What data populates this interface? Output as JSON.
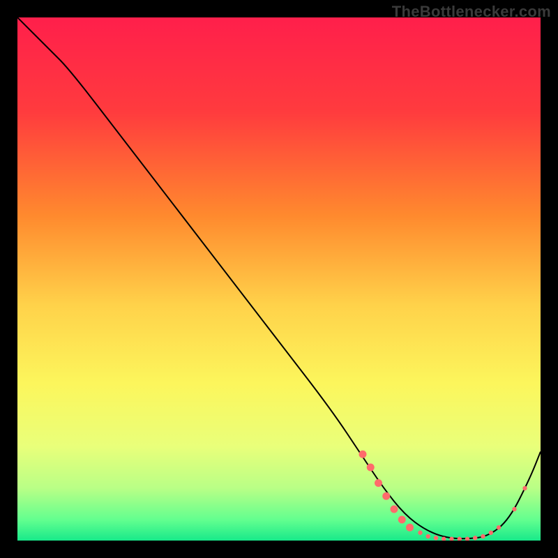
{
  "watermark": "TheBottlenecker.com",
  "chart_data": {
    "type": "line",
    "title": "",
    "xlabel": "",
    "ylabel": "",
    "xlim": [
      0,
      100
    ],
    "ylim": [
      0,
      100
    ],
    "background_gradient": {
      "stops": [
        {
          "offset": 0,
          "color": "#ff1f4b"
        },
        {
          "offset": 18,
          "color": "#ff3b3e"
        },
        {
          "offset": 38,
          "color": "#ff8a2e"
        },
        {
          "offset": 55,
          "color": "#ffd24a"
        },
        {
          "offset": 70,
          "color": "#fcf65c"
        },
        {
          "offset": 82,
          "color": "#e9ff7a"
        },
        {
          "offset": 90,
          "color": "#b9ff86"
        },
        {
          "offset": 96,
          "color": "#63ff8f"
        },
        {
          "offset": 100,
          "color": "#18e98a"
        }
      ]
    },
    "series": [
      {
        "name": "bottleneck-curve",
        "color": "#000000",
        "x": [
          0,
          6,
          10,
          20,
          30,
          40,
          50,
          60,
          66,
          70,
          74,
          78,
          82,
          86,
          90,
          94,
          98,
          100
        ],
        "y": [
          100,
          94,
          90,
          77,
          64,
          51,
          38,
          25,
          16,
          10,
          5,
          2,
          0.5,
          0.3,
          0.8,
          4,
          12,
          17
        ]
      }
    ],
    "markers": {
      "name": "highlight-points",
      "color": "#ff6b6b",
      "radius_small": 3.2,
      "radius_large": 5.5,
      "points": [
        {
          "x": 66.0,
          "y": 16.5,
          "r": "l"
        },
        {
          "x": 67.5,
          "y": 14.0,
          "r": "l"
        },
        {
          "x": 69.0,
          "y": 11.0,
          "r": "l"
        },
        {
          "x": 70.5,
          "y": 8.5,
          "r": "l"
        },
        {
          "x": 72.0,
          "y": 6.0,
          "r": "l"
        },
        {
          "x": 73.5,
          "y": 4.0,
          "r": "l"
        },
        {
          "x": 75.0,
          "y": 2.5,
          "r": "l"
        },
        {
          "x": 77.0,
          "y": 1.5,
          "r": "s"
        },
        {
          "x": 78.5,
          "y": 0.8,
          "r": "s"
        },
        {
          "x": 80.0,
          "y": 0.5,
          "r": "s"
        },
        {
          "x": 81.5,
          "y": 0.3,
          "r": "s"
        },
        {
          "x": 83.0,
          "y": 0.3,
          "r": "s"
        },
        {
          "x": 84.5,
          "y": 0.3,
          "r": "s"
        },
        {
          "x": 86.0,
          "y": 0.3,
          "r": "s"
        },
        {
          "x": 87.5,
          "y": 0.5,
          "r": "s"
        },
        {
          "x": 89.0,
          "y": 0.8,
          "r": "s"
        },
        {
          "x": 90.5,
          "y": 1.5,
          "r": "s"
        },
        {
          "x": 92.0,
          "y": 2.5,
          "r": "s"
        },
        {
          "x": 95.0,
          "y": 6.0,
          "r": "s"
        },
        {
          "x": 97.0,
          "y": 10.0,
          "r": "s"
        }
      ]
    }
  }
}
